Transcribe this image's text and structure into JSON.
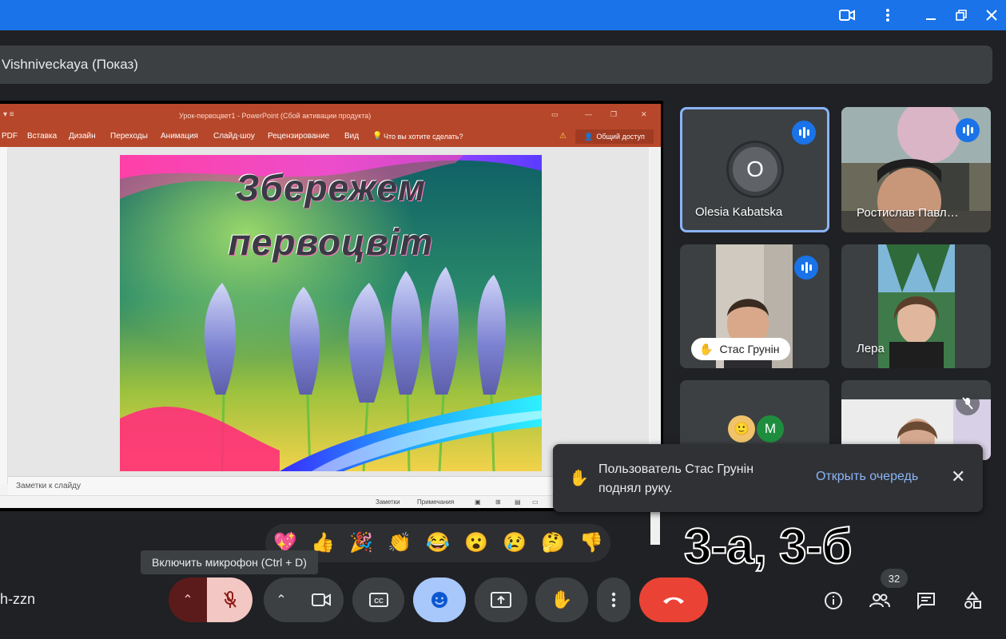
{
  "window": {
    "camera_icon": "video-camera-icon",
    "menu_icon": "more-vert-icon",
    "minimize_icon": "minimize-icon",
    "restore_icon": "restore-icon",
    "close_icon": "close-icon"
  },
  "presenter": {
    "label": "Vishniveckaya (Показ)"
  },
  "powerpoint": {
    "title": "Урок-первоцвет1 - PowerPoint (Сбой активации продукта)",
    "menu": [
      "PDF",
      "Вставка",
      "Дизайн",
      "Переходы",
      "Анимация",
      "Слайд-шоу",
      "Рецензирование",
      "Вид",
      "Что вы хотите сделать?"
    ],
    "share_label": "Общий доступ",
    "slide_title_line1": "Збережем",
    "slide_title_line2": "первоцвіт",
    "notes_placeholder": "Заметки к слайду",
    "status_notes": "Заметки",
    "status_comments": "Примечания"
  },
  "participants": [
    {
      "name": "Olesia Kabatska",
      "initial": "O",
      "speaking": true
    },
    {
      "name": "Ростислав Павл…",
      "speaking": true
    },
    {
      "name": "Стас Грунін",
      "speaking": true,
      "hand_raised": true
    },
    {
      "name": "Лера",
      "speaking": false
    },
    {
      "name": "",
      "initial": "M",
      "speaking": false
    },
    {
      "name": "",
      "muted": true
    }
  ],
  "toast": {
    "message": "Пользователь Стас Грунін поднял руку.",
    "action": "Открыть очередь",
    "close": "✕"
  },
  "reactions": [
    "💖",
    "👍",
    "🎉",
    "👏",
    "😂",
    "😮",
    "😢",
    "🤔",
    "👎"
  ],
  "tooltip": "Включить микрофон (Ctrl + D)",
  "overlay_text": "3-а, 3-б",
  "meeting_code": "h-zzn",
  "participant_count": "32",
  "colors": {
    "accent": "#1a73e8",
    "end_call": "#ea4335",
    "mic_off_bg": "#f2c7c4",
    "reaction_active": "#a8c7fa"
  }
}
